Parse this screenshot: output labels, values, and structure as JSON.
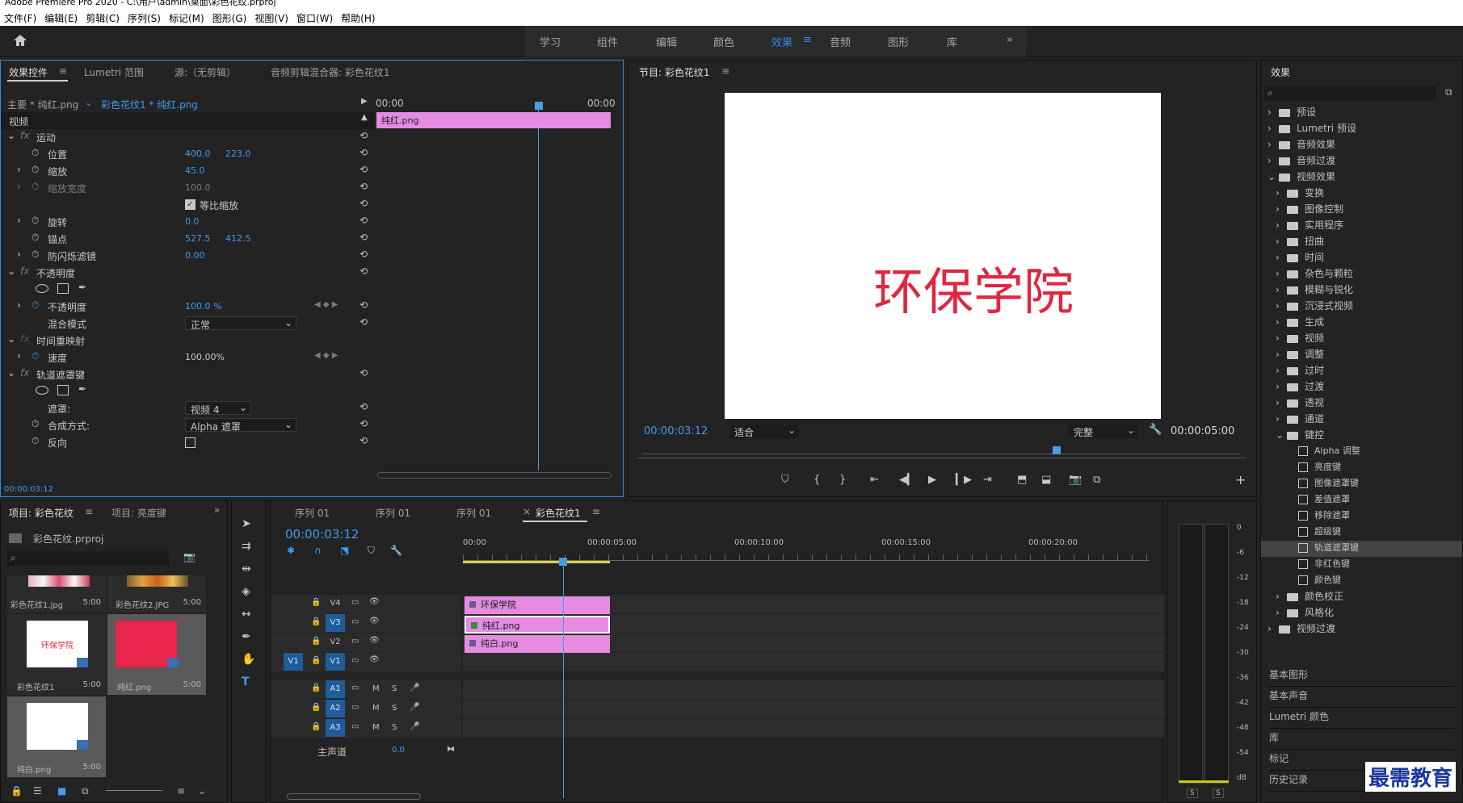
{
  "window": {
    "title": "Adobe Premiere Pro 2020 - C:\\用户\\admin\\桌面\\彩色花纹.prproj"
  },
  "menu": [
    "文件(F)",
    "编辑(E)",
    "剪辑(C)",
    "序列(S)",
    "标记(M)",
    "图形(G)",
    "视图(V)",
    "窗口(W)",
    "帮助(H)"
  ],
  "workspaces": [
    "学习",
    "组件",
    "编辑",
    "颜色",
    "效果",
    "音频",
    "图形",
    "库"
  ],
  "active_workspace": "效果",
  "effect_controls": {
    "tabs": [
      "效果控件",
      "Lumetri 范围",
      "源:（无剪辑）",
      "音频剪辑混合器: 彩色花纹1"
    ],
    "master": "主要 * 纯红.png",
    "sequence_clip": "彩色花纹1 * 纯红.png",
    "timecode_start": "00:00",
    "timecode_end": "00:00",
    "clip_label": "纯红.png",
    "section_video": "视频",
    "motion": "运动",
    "position_label": "位置",
    "position_x": "400.0",
    "position_y": "223.0",
    "scale_label": "缩放",
    "scale_value": "45.0",
    "scale_width_label": "缩放宽度",
    "scale_width_value": "100.0",
    "uniform_scale": "等比缩放",
    "rotation_label": "旋转",
    "rotation_value": "0.0",
    "anchor_label": "锚点",
    "anchor_x": "527.5",
    "anchor_y": "412.5",
    "antiflicker_label": "防闪烁滤镜",
    "antiflicker_value": "0.00",
    "opacity_section": "不透明度",
    "opacity_label": "不透明度",
    "opacity_value": "100.0 %",
    "blend_label": "混合模式",
    "blend_value": "正常",
    "time_remap": "时间重映射",
    "speed_label": "速度",
    "speed_value": "100.00%",
    "track_matte": "轨道遮罩键",
    "matte_label": "遮罩:",
    "matte_value": "视频 4",
    "composite_label": "合成方式:",
    "composite_value": "Alpha 遮罩",
    "reverse_label": "反向",
    "current_time": "00:00:03:12"
  },
  "program": {
    "title": "节目: 彩色花纹1",
    "overlay_text": "环保学院",
    "timecode": "00:00:03:12",
    "fit": "适合",
    "quality": "完整",
    "duration": "00:00:05:00"
  },
  "effects_panel": {
    "title": "效果",
    "items": [
      {
        "label": "预设",
        "kind": "preset",
        "indent": 0,
        "open": false
      },
      {
        "label": "Lumetri 预设",
        "kind": "preset",
        "indent": 0,
        "open": false
      },
      {
        "label": "音频效果",
        "kind": "folder",
        "indent": 0,
        "open": false
      },
      {
        "label": "音频过渡",
        "kind": "folder",
        "indent": 0,
        "open": false
      },
      {
        "label": "视频效果",
        "kind": "folder",
        "indent": 0,
        "open": true
      },
      {
        "label": "变换",
        "kind": "folder",
        "indent": 1,
        "open": false
      },
      {
        "label": "图像控制",
        "kind": "folder",
        "indent": 1,
        "open": false
      },
      {
        "label": "实用程序",
        "kind": "folder",
        "indent": 1,
        "open": false
      },
      {
        "label": "扭曲",
        "kind": "folder",
        "indent": 1,
        "open": false
      },
      {
        "label": "时间",
        "kind": "folder",
        "indent": 1,
        "open": false
      },
      {
        "label": "杂色与颗粒",
        "kind": "folder",
        "indent": 1,
        "open": false
      },
      {
        "label": "模糊与锐化",
        "kind": "folder",
        "indent": 1,
        "open": false
      },
      {
        "label": "沉浸式视频",
        "kind": "folder",
        "indent": 1,
        "open": false
      },
      {
        "label": "生成",
        "kind": "folder",
        "indent": 1,
        "open": false
      },
      {
        "label": "视频",
        "kind": "folder",
        "indent": 1,
        "open": false
      },
      {
        "label": "调整",
        "kind": "folder",
        "indent": 1,
        "open": false
      },
      {
        "label": "过时",
        "kind": "folder",
        "indent": 1,
        "open": false
      },
      {
        "label": "过渡",
        "kind": "folder",
        "indent": 1,
        "open": false
      },
      {
        "label": "透视",
        "kind": "folder",
        "indent": 1,
        "open": false
      },
      {
        "label": "通道",
        "kind": "folder",
        "indent": 1,
        "open": false
      },
      {
        "label": "键控",
        "kind": "folder",
        "indent": 1,
        "open": true
      },
      {
        "label": "Alpha 调整",
        "kind": "effect",
        "indent": 2
      },
      {
        "label": "亮度键",
        "kind": "effect",
        "indent": 2
      },
      {
        "label": "图像遮罩键",
        "kind": "effect",
        "indent": 2
      },
      {
        "label": "差值遮罩",
        "kind": "effect",
        "indent": 2
      },
      {
        "label": "移除遮罩",
        "kind": "effect",
        "indent": 2
      },
      {
        "label": "超级键",
        "kind": "effect",
        "indent": 2
      },
      {
        "label": "轨道遮罩键",
        "kind": "effect",
        "indent": 2,
        "selected": true
      },
      {
        "label": "非红色键",
        "kind": "effect",
        "indent": 2
      },
      {
        "label": "颜色键",
        "kind": "effect",
        "indent": 2
      },
      {
        "label": "颜色校正",
        "kind": "folder",
        "indent": 1,
        "open": false
      },
      {
        "label": "风格化",
        "kind": "folder",
        "indent": 1,
        "open": false
      },
      {
        "label": "视频过渡",
        "kind": "folder",
        "indent": 0,
        "open": false
      }
    ],
    "bottom": [
      "基本图形",
      "基本声音",
      "Lumetri 颜色",
      "库",
      "标记",
      "历史记录"
    ]
  },
  "project": {
    "tabs": [
      "项目: 彩色花纹",
      "项目: 亮度键"
    ],
    "file": "彩色花纹.prproj",
    "items": [
      {
        "name": "彩色花纹1.jpg",
        "dur": "5:00"
      },
      {
        "name": "彩色花纹2.JPG",
        "dur": "5:00"
      },
      {
        "name": "彩色花纹1",
        "dur": "5:00",
        "preview": "环保学院"
      },
      {
        "name": "纯红.png",
        "dur": "5:00"
      },
      {
        "name": "纯白.png",
        "dur": "5:00"
      }
    ]
  },
  "timeline": {
    "tabs": [
      "序列 01",
      "序列 01",
      "序列 01",
      "彩色花纹1"
    ],
    "timecode": "00:00:03:12",
    "ruler": [
      "00:00",
      "00:00:05:00",
      "00:00:10:00",
      "00:00:15:00",
      "00:00:20:00"
    ],
    "video_tracks": [
      "V4",
      "V3",
      "V2",
      "V1"
    ],
    "audio_tracks": [
      "A1",
      "A2",
      "A3"
    ],
    "master": "主声道",
    "master_value": "0.0",
    "clips": [
      "环保学院",
      "纯红.png",
      "纯白.png"
    ],
    "mute": "M",
    "solo": "S"
  },
  "meter": {
    "ticks": [
      "0",
      "-6",
      "-12",
      "-18",
      "-24",
      "-30",
      "-36",
      "-42",
      "-48",
      "-54",
      "dB"
    ],
    "solo": [
      "S",
      "S"
    ]
  },
  "watermark": "最需教育",
  "colors": {
    "accent": "#2d8ceb",
    "clip": "#e58be2",
    "red_text": "#e0273f"
  }
}
